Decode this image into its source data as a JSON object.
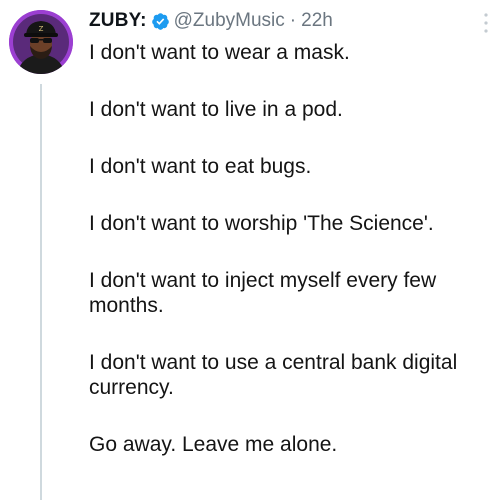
{
  "author": {
    "display_name": "ZUBY:",
    "handle": "@ZubyMusic",
    "separator": "·",
    "timestamp": "22h",
    "verified": true,
    "avatar_bg_color": "#9b3fd1",
    "verified_color": "#1d9bf0"
  },
  "tweet": {
    "lines": [
      "I don't want to wear a mask.",
      "I don't want to live in a pod.",
      "I don't want to eat bugs.",
      "I don't want to worship 'The Science'.",
      "I don't want to inject myself every few months.",
      "I don't want to use a central bank digital currency.",
      "Go away. Leave me alone."
    ]
  },
  "icons": {
    "verified": "verified-badge-icon",
    "more": "more-options-icon"
  }
}
